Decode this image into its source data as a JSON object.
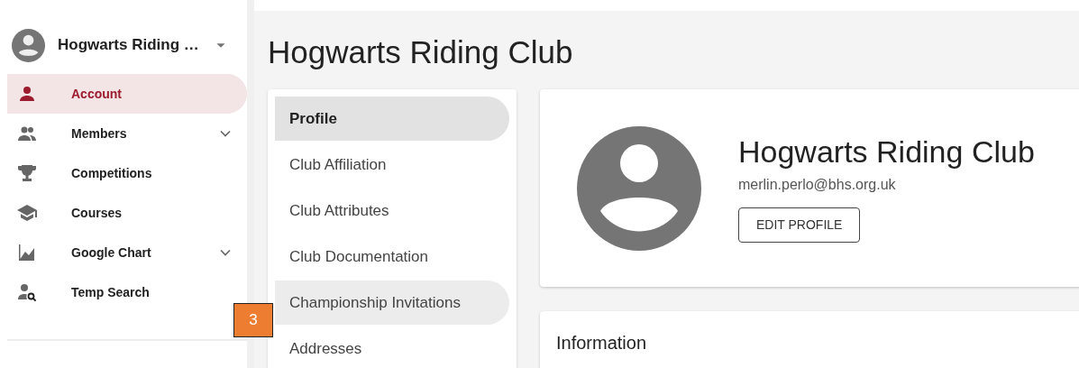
{
  "sidebar": {
    "account_name": "Hogwarts Riding …",
    "items": [
      {
        "label": "Account",
        "selected": true
      },
      {
        "label": "Members",
        "selected": false,
        "expanded": false
      },
      {
        "label": "Competitions",
        "selected": false
      },
      {
        "label": "Courses",
        "selected": false
      },
      {
        "label": "Google Chart",
        "selected": false,
        "expanded": false
      },
      {
        "label": "Temp Search",
        "selected": false
      }
    ]
  },
  "page_title": "Hogwarts Riding Club",
  "submenu": [
    {
      "label": "Profile",
      "selected": true,
      "hovered": false
    },
    {
      "label": "Club Affiliation",
      "selected": false,
      "hovered": false
    },
    {
      "label": "Club Attributes",
      "selected": false,
      "hovered": false
    },
    {
      "label": "Club Documentation",
      "selected": false,
      "hovered": false
    },
    {
      "label": "Championship Invitations",
      "selected": false,
      "hovered": true
    },
    {
      "label": "Addresses",
      "selected": false,
      "hovered": false
    }
  ],
  "callout": "3",
  "profile": {
    "name": "Hogwarts Riding Club",
    "email": "merlin.perlo@bhs.org.uk",
    "button": "EDIT PROFILE"
  },
  "information": {
    "title": "Information"
  }
}
